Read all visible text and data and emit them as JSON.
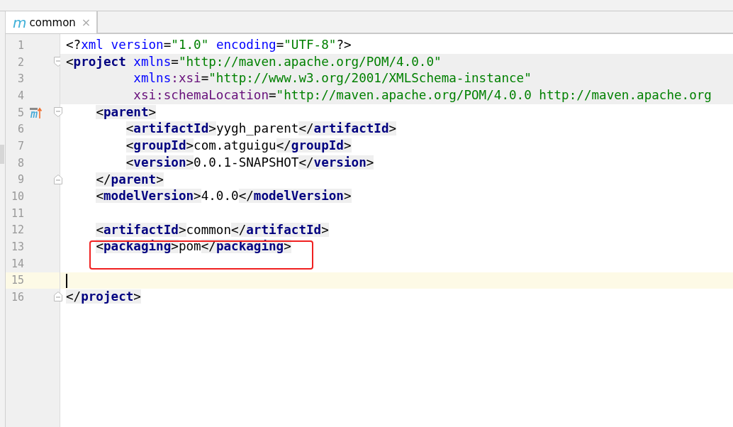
{
  "tabs": [
    {
      "icon": "m",
      "label": "common",
      "close": "×",
      "selected": true
    }
  ],
  "editor": {
    "lines": [
      {
        "number": "1",
        "kind": "plain",
        "highlighted": false,
        "current": false,
        "tokens": [
          {
            "kind": "pi",
            "text": "<?"
          },
          {
            "kind": "attr",
            "text": "xml"
          },
          {
            "kind": "attr",
            "text": " version"
          },
          {
            "kind": "eq",
            "text": "="
          },
          {
            "kind": "value",
            "text": "\"1.0\""
          },
          {
            "kind": "attr",
            "text": " encoding"
          },
          {
            "kind": "eq",
            "text": "="
          },
          {
            "kind": "value",
            "text": "\"UTF-8\""
          },
          {
            "kind": "pi",
            "text": "?>"
          }
        ]
      },
      {
        "number": "2",
        "kind": "opener",
        "highlighted": true,
        "current": false,
        "tokens": [
          {
            "kind": "bracket",
            "text": "<"
          },
          {
            "kind": "tag",
            "text": "project"
          },
          {
            "kind": "attr",
            "text": " xmlns"
          },
          {
            "kind": "eq",
            "text": "="
          },
          {
            "kind": "value",
            "text": "\"http://maven.apache.org/POM/4.0.0\""
          }
        ]
      },
      {
        "number": "3",
        "kind": "plain",
        "highlighted": true,
        "current": false,
        "tokens": [
          {
            "kind": "attr",
            "text": "         xmlns"
          },
          {
            "kind": "ns",
            "text": ":xsi"
          },
          {
            "kind": "eq",
            "text": "="
          },
          {
            "kind": "value",
            "text": "\"http://www.w3.org/2001/XMLSchema-instance\""
          }
        ]
      },
      {
        "number": "4",
        "kind": "plain",
        "highlighted": true,
        "current": false,
        "tokens": [
          {
            "kind": "ns",
            "text": "         xsi:schemaLocation"
          },
          {
            "kind": "eq",
            "text": "="
          },
          {
            "kind": "value",
            "text": "\"http://maven.apache.org/POM/4.0.0 http://maven.apache.org"
          }
        ]
      },
      {
        "number": "5",
        "kind": "opener",
        "marker": true,
        "highlighted": false,
        "current": false,
        "tokens": [
          {
            "kind": "bracket",
            "text": "    <"
          },
          {
            "kind": "tag",
            "text": "parent"
          },
          {
            "kind": "bracket",
            "text": ">"
          }
        ]
      },
      {
        "number": "6",
        "kind": "plain",
        "highlighted": false,
        "current": false,
        "tokens": [
          {
            "kind": "bracket",
            "text": "        <"
          },
          {
            "kind": "tag",
            "text": "artifactId"
          },
          {
            "kind": "bracket",
            "text": ">"
          },
          {
            "kind": "plain",
            "text": "yygh_parent"
          },
          {
            "kind": "bracket",
            "text": "</"
          },
          {
            "kind": "tag",
            "text": "artifactId"
          },
          {
            "kind": "bracket",
            "text": ">"
          }
        ]
      },
      {
        "number": "7",
        "kind": "plain",
        "highlighted": false,
        "current": false,
        "tokens": [
          {
            "kind": "bracket",
            "text": "        <"
          },
          {
            "kind": "tag",
            "text": "groupId"
          },
          {
            "kind": "bracket",
            "text": ">"
          },
          {
            "kind": "plain",
            "text": "com.atguigu"
          },
          {
            "kind": "bracket",
            "text": "</"
          },
          {
            "kind": "tag",
            "text": "groupId"
          },
          {
            "kind": "bracket",
            "text": ">"
          }
        ]
      },
      {
        "number": "8",
        "kind": "plain",
        "highlighted": false,
        "current": false,
        "tokens": [
          {
            "kind": "bracket",
            "text": "        <"
          },
          {
            "kind": "tag",
            "text": "version"
          },
          {
            "kind": "bracket",
            "text": ">"
          },
          {
            "kind": "plain",
            "text": "0.0.1-SNAPSHOT"
          },
          {
            "kind": "bracket",
            "text": "</"
          },
          {
            "kind": "tag",
            "text": "version"
          },
          {
            "kind": "bracket",
            "text": ">"
          }
        ]
      },
      {
        "number": "9",
        "kind": "closer",
        "highlighted": false,
        "current": false,
        "tokens": [
          {
            "kind": "bracket",
            "text": "    </"
          },
          {
            "kind": "tag",
            "text": "parent"
          },
          {
            "kind": "bracket",
            "text": ">"
          }
        ]
      },
      {
        "number": "10",
        "kind": "plain",
        "highlighted": false,
        "current": false,
        "tokens": [
          {
            "kind": "bracket",
            "text": "    <"
          },
          {
            "kind": "tag",
            "text": "modelVersion"
          },
          {
            "kind": "bracket",
            "text": ">"
          },
          {
            "kind": "plain",
            "text": "4.0.0"
          },
          {
            "kind": "bracket",
            "text": "</"
          },
          {
            "kind": "tag",
            "text": "modelVersion"
          },
          {
            "kind": "bracket",
            "text": ">"
          }
        ]
      },
      {
        "number": "11",
        "kind": "plain",
        "highlighted": false,
        "current": false
      },
      {
        "number": "12",
        "kind": "plain",
        "highlighted": false,
        "current": false,
        "tokens": [
          {
            "kind": "bracket",
            "text": "    <"
          },
          {
            "kind": "tag",
            "text": "artifactId"
          },
          {
            "kind": "bracket",
            "text": ">"
          },
          {
            "kind": "plain",
            "text": "common"
          },
          {
            "kind": "bracket",
            "text": "</"
          },
          {
            "kind": "tag",
            "text": "artifactId"
          },
          {
            "kind": "bracket",
            "text": ">"
          }
        ]
      },
      {
        "number": "13",
        "kind": "plain",
        "annotated": true,
        "highlighted": false,
        "current": false,
        "tokens": [
          {
            "kind": "bracket",
            "text": "    <"
          },
          {
            "kind": "tag",
            "text": "packaging"
          },
          {
            "kind": "bracket",
            "text": ">"
          },
          {
            "kind": "plain",
            "text": "pom"
          },
          {
            "kind": "bracket",
            "text": "</"
          },
          {
            "kind": "tag",
            "text": "packaging"
          },
          {
            "kind": "bracket",
            "text": ">"
          }
        ]
      },
      {
        "number": "14",
        "kind": "plain",
        "highlighted": false,
        "current": false
      },
      {
        "number": "15",
        "kind": "plain",
        "highlighted": false,
        "current": true
      },
      {
        "number": "16",
        "kind": "closer",
        "highlighted": false,
        "current": false,
        "tokens": [
          {
            "kind": "bracket",
            "text": "</"
          },
          {
            "kind": "tag",
            "text": "project"
          },
          {
            "kind": "bracket",
            "text": ">"
          }
        ]
      }
    ]
  }
}
